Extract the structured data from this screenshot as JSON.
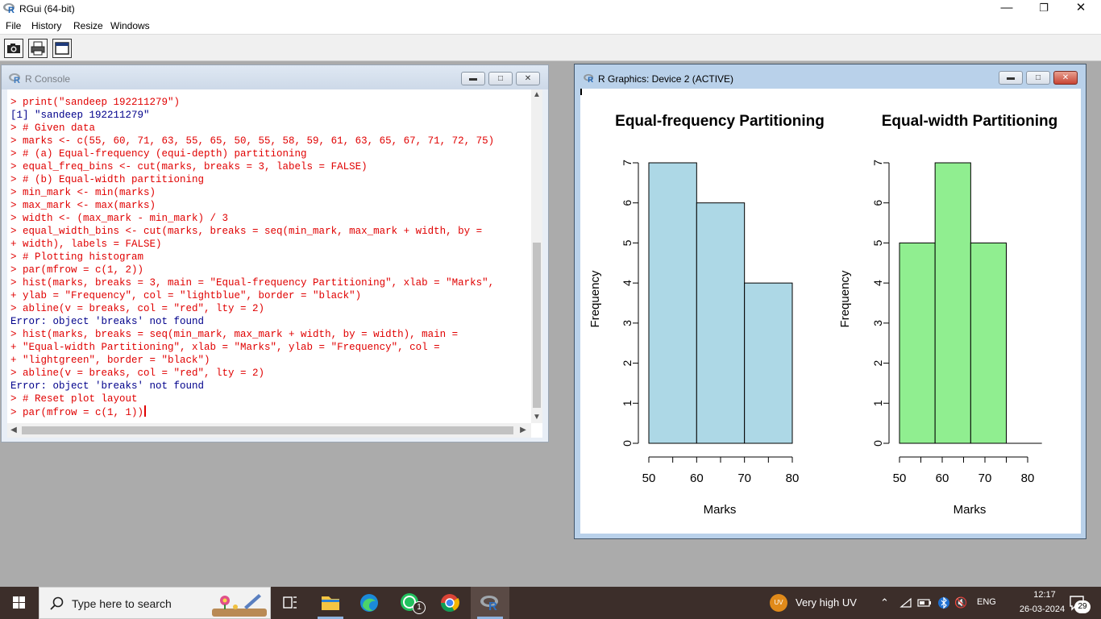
{
  "app": {
    "title": "RGui (64-bit)",
    "window_controls": {
      "minimize": "—",
      "restore": "❐",
      "close": "✕"
    }
  },
  "menu": [
    "File",
    "History",
    "Resize",
    "Windows"
  ],
  "toolbar": {
    "buttons": [
      "camera-icon",
      "printer-icon",
      "window-icon"
    ]
  },
  "console": {
    "title": "R Console",
    "lines": [
      {
        "kind": "cmd",
        "text": "> print(\"sandeep 192211279\")"
      },
      {
        "kind": "out",
        "text": "[1] \"sandeep 192211279\""
      },
      {
        "kind": "cmd",
        "text": "> # Given data"
      },
      {
        "kind": "cmd",
        "text": "> marks <- c(55, 60, 71, 63, 55, 65, 50, 55, 58, 59, 61, 63, 65, 67, 71, 72, 75)"
      },
      {
        "kind": "cmd",
        "text": "> # (a) Equal-frequency (equi-depth) partitioning"
      },
      {
        "kind": "cmd",
        "text": "> equal_freq_bins <- cut(marks, breaks = 3, labels = FALSE)"
      },
      {
        "kind": "cmd",
        "text": "> # (b) Equal-width partitioning"
      },
      {
        "kind": "cmd",
        "text": "> min_mark <- min(marks)"
      },
      {
        "kind": "cmd",
        "text": "> max_mark <- max(marks)"
      },
      {
        "kind": "cmd",
        "text": "> width <- (max_mark - min_mark) / 3"
      },
      {
        "kind": "cmd",
        "text": "> equal_width_bins <- cut(marks, breaks = seq(min_mark, max_mark + width, by ="
      },
      {
        "kind": "cmd",
        "text": "+ width), labels = FALSE)"
      },
      {
        "kind": "cmd",
        "text": "> # Plotting histogram"
      },
      {
        "kind": "cmd",
        "text": "> par(mfrow = c(1, 2))"
      },
      {
        "kind": "cmd",
        "text": "> hist(marks, breaks = 3, main = \"Equal-frequency Partitioning\", xlab = \"Marks\","
      },
      {
        "kind": "cmd",
        "text": "+ ylab = \"Frequency\", col = \"lightblue\", border = \"black\")"
      },
      {
        "kind": "cmd",
        "text": "> abline(v = breaks, col = \"red\", lty = 2)"
      },
      {
        "kind": "out",
        "text": "Error: object 'breaks' not found"
      },
      {
        "kind": "cmd",
        "text": "> hist(marks, breaks = seq(min_mark, max_mark + width, by = width), main ="
      },
      {
        "kind": "cmd",
        "text": "+ \"Equal-width Partitioning\", xlab = \"Marks\", ylab = \"Frequency\", col ="
      },
      {
        "kind": "cmd",
        "text": "+ \"lightgreen\", border = \"black\")"
      },
      {
        "kind": "cmd",
        "text": "> abline(v = breaks, col = \"red\", lty = 2)"
      },
      {
        "kind": "out",
        "text": "Error: object 'breaks' not found"
      },
      {
        "kind": "cmd",
        "text": "> # Reset plot layout"
      },
      {
        "kind": "cmd",
        "text": "> par(mfrow = c(1, 1))"
      }
    ]
  },
  "graphics_window": {
    "title": "R Graphics: Device 2 (ACTIVE)"
  },
  "chart_data": [
    {
      "type": "bar",
      "title": "Equal-frequency Partitioning",
      "xlabel": "Marks",
      "ylabel": "Frequency",
      "bins": [
        {
          "start": 50,
          "end": 60,
          "count": 7
        },
        {
          "start": 60,
          "end": 70,
          "count": 6
        },
        {
          "start": 70,
          "end": 80,
          "count": 4
        }
      ],
      "xlim": [
        50,
        80
      ],
      "xticks": [
        50,
        55,
        60,
        65,
        70,
        75,
        80
      ],
      "xtick_labels": [
        "50",
        "60",
        "70",
        "80"
      ],
      "ylim": [
        0,
        7
      ],
      "yticks": [
        0,
        1,
        2,
        3,
        4,
        5,
        6,
        7
      ],
      "color": "#add8e6",
      "border": "#000000",
      "grid": false
    },
    {
      "type": "bar",
      "title": "Equal-width Partitioning",
      "xlabel": "Marks",
      "ylabel": "Frequency",
      "bins": [
        {
          "start": 50,
          "end": 58.33,
          "count": 5
        },
        {
          "start": 58.33,
          "end": 66.67,
          "count": 7
        },
        {
          "start": 66.67,
          "end": 75,
          "count": 5
        },
        {
          "start": 75,
          "end": 83.33,
          "count": 0
        }
      ],
      "xlim": [
        50,
        80
      ],
      "xticks": [
        50,
        55,
        60,
        65,
        70,
        75,
        80
      ],
      "xtick_labels": [
        "50",
        "60",
        "70",
        "80"
      ],
      "ylim": [
        0,
        7
      ],
      "yticks": [
        0,
        1,
        2,
        3,
        4,
        5,
        6,
        7
      ],
      "color": "#90ee90",
      "border": "#000000",
      "grid": false
    }
  ],
  "taskbar": {
    "search_placeholder": "Type here to search",
    "apps": [
      "task-view-icon",
      "file-explorer-icon",
      "edge-icon",
      "whatsapp-icon",
      "chrome-icon",
      "r-gui-icon"
    ],
    "whatsapp_badge": "1",
    "weather_badge": "UV",
    "weather_text": "Very high UV",
    "language": "ENG",
    "time": "12:17",
    "date": "26-03-2024",
    "notification_count": "29"
  }
}
